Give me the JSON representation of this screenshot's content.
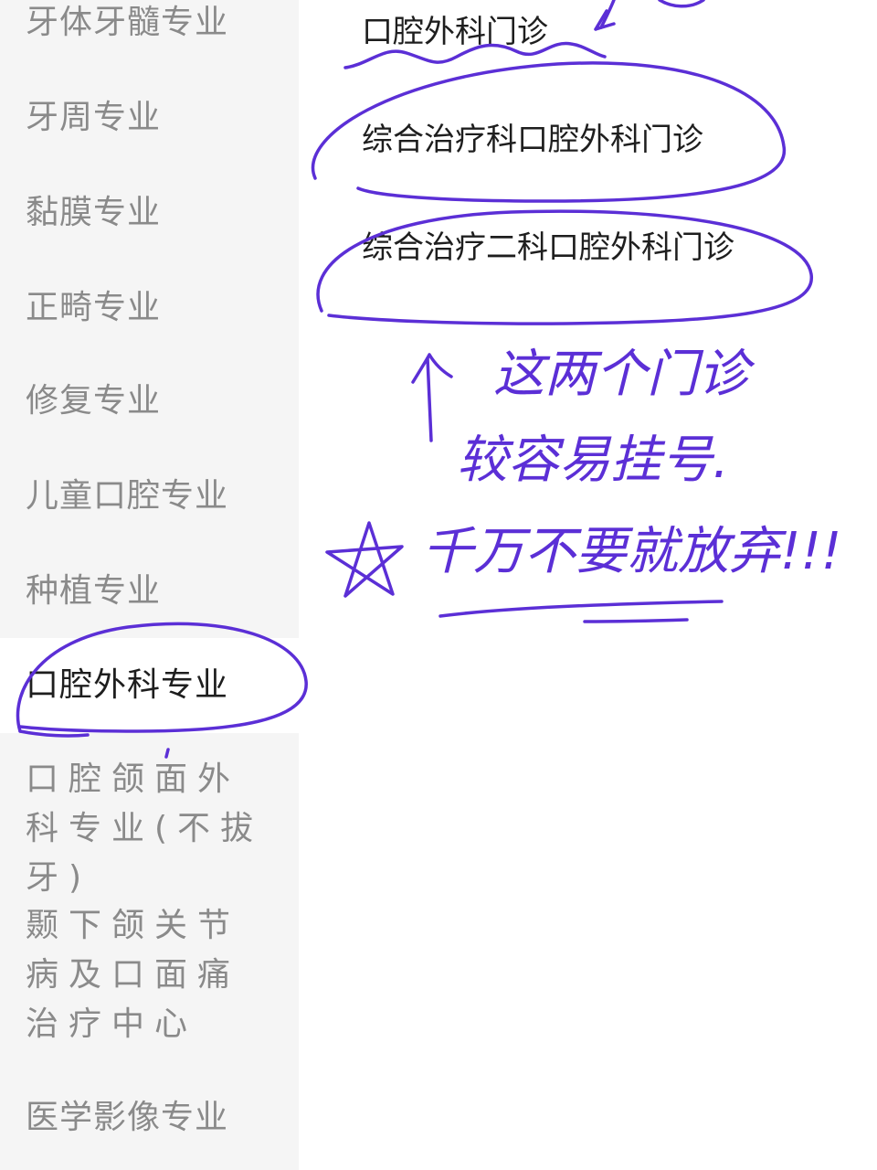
{
  "sidebar": {
    "items": [
      {
        "label": "牙体牙髓专业"
      },
      {
        "label": "牙周专业"
      },
      {
        "label": "黏膜专业"
      },
      {
        "label": "正畸专业"
      },
      {
        "label": "修复专业"
      },
      {
        "label": "儿童口腔专业"
      },
      {
        "label": "种植专业"
      },
      {
        "label": "口腔外科专业",
        "selected": true
      },
      {
        "label": "口腔颌面外科专业(不拔牙)"
      },
      {
        "label": "颞下颌关节病及口面痛治疗中心"
      },
      {
        "label": "医学影像专业"
      }
    ]
  },
  "clinics": [
    {
      "label": "口腔外科门诊"
    },
    {
      "label": "综合治疗科口腔外科门诊"
    },
    {
      "label": "综合治疗二科口腔外科门诊"
    }
  ],
  "annotation": {
    "ink_color": "#5b2fd6"
  }
}
